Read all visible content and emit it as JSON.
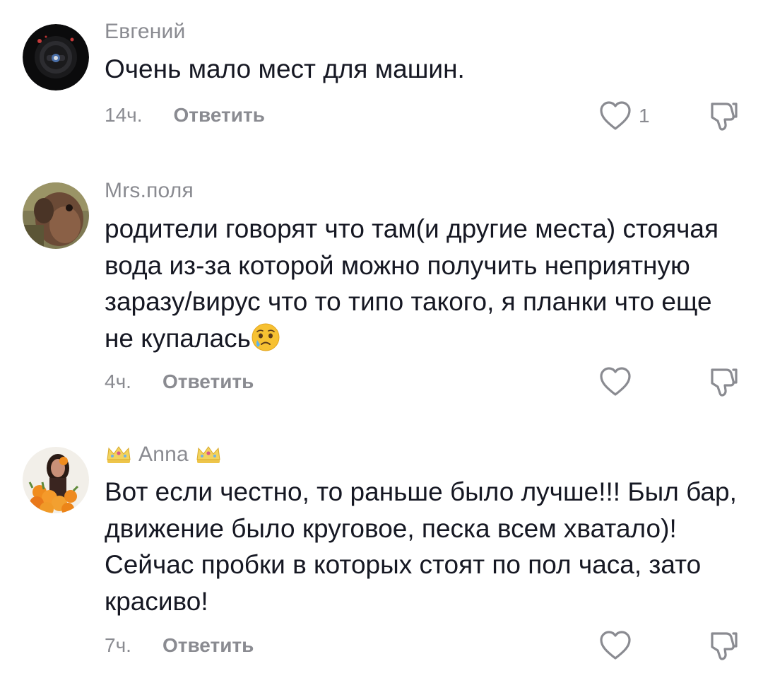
{
  "comments": [
    {
      "username": "Евгений",
      "text": "Очень мало мест для машин.",
      "time": "14ч.",
      "reply_label": "Ответить",
      "like_count": "1",
      "avatar_icon": "steering-wheel-avatar"
    },
    {
      "username": "Mrs.поля",
      "text": "родители говорят что там(и другие места) стоячая вода из-за которой можно получить неприятную заразу/вирус что то типо такого, я планки что еще не купалась",
      "emoji": "crying-face-emoji",
      "time": "4ч.",
      "reply_label": "Ответить",
      "like_count": "",
      "avatar_icon": "horse-avatar"
    },
    {
      "username": "Anna",
      "username_decorations": [
        "crown-icon",
        "crown-icon"
      ],
      "text": "Вот если честно, то раньше было лучше!!! Был бар, движение было круговое, песка всем хватало)! Сейчас пробки в которых стоят по пол часа, зато красиво!",
      "time": "7ч.",
      "reply_label": "Ответить",
      "like_count": "",
      "avatar_icon": "woman-with-flowers-avatar"
    }
  ],
  "colors": {
    "text": "#161823",
    "secondary": "#8a8b91",
    "background": "#ffffff"
  }
}
